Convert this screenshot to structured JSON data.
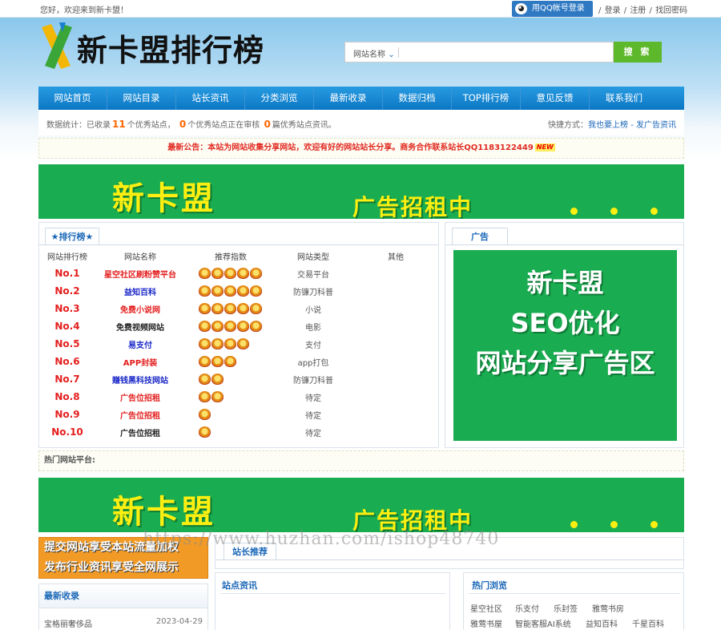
{
  "topbar": {
    "welcome": "您好，欢迎来到新卡盟！",
    "qq_icon": "qq-penguin-icon",
    "qq_login": "用QQ帐号登录",
    "links": [
      "登录",
      "注册",
      "找回密码"
    ],
    "sep": "/"
  },
  "header": {
    "logo_text": "新卡盟排行榜",
    "logo_colors": [
      "#f2b705",
      "#3aa637",
      "#1b7fd1"
    ],
    "search_select": "网站名称",
    "search_button": "搜 索"
  },
  "nav": [
    "网站首页",
    "网站目录",
    "站长资讯",
    "分类浏览",
    "最新收录",
    "数据归档",
    "TOP排行榜",
    "意见反馈",
    "联系我们"
  ],
  "stats": {
    "p1": "数据统计：已收录",
    "n1": "11",
    "p2": "个优秀站点，",
    "n2": "0",
    "p3": "个优秀站点正在审核",
    "n3": "0",
    "p4": "篇优秀站点资讯。",
    "shortcut_label": "快捷方式：",
    "shortcut_link1": "我也要上榜",
    "shortcut_sep": " - ",
    "shortcut_link2": "发广告资讯"
  },
  "notice": {
    "text": "最新公告：本站为网站收集分享网站，欢迎有好的网站站长分享。商务合作联系站长QQ1183122449",
    "badge": "NEW"
  },
  "banner1": {
    "big": "新卡盟",
    "small": "广告招租中"
  },
  "ranking": {
    "tab": "★排行榜★",
    "headers": [
      "网站排行榜",
      "网站名称",
      "推荐指数",
      "网站类型",
      "其他"
    ],
    "rows": [
      {
        "no": "No.1",
        "name": "星空社区刷粉赞平台",
        "stars": 5,
        "type": "交易平台",
        "color": "#e41e1e"
      },
      {
        "no": "No.2",
        "name": "益知百科",
        "stars": 5,
        "type": "防镰刀科普",
        "color": "#1a27c8"
      },
      {
        "no": "No.3",
        "name": "免费小说网",
        "stars": 5,
        "type": "小说",
        "color": "#e41e1e"
      },
      {
        "no": "No.4",
        "name": "免费视频网站",
        "stars": 5,
        "type": "电影",
        "color": "#222222"
      },
      {
        "no": "No.5",
        "name": "易支付",
        "stars": 4,
        "type": "支付",
        "color": "#1a27c8"
      },
      {
        "no": "No.6",
        "name": "APP封装",
        "stars": 3,
        "type": "app打包",
        "color": "#e41e1e"
      },
      {
        "no": "No.7",
        "name": "赚钱黑科技网站",
        "stars": 2,
        "type": "防镰刀科普",
        "color": "#1a27c8"
      },
      {
        "no": "No.8",
        "name": "广告位招租",
        "stars": 2,
        "type": "待定",
        "color": "#e41e1e"
      },
      {
        "no": "No.9",
        "name": "广告位招租",
        "stars": 1,
        "type": "待定",
        "color": "#e41e1e"
      },
      {
        "no": "No.10",
        "name": "广告位招租",
        "stars": 1,
        "type": "待定",
        "color": "#222222"
      }
    ]
  },
  "ad": {
    "tab": "广告",
    "lines": [
      "新卡盟",
      "SEO优化",
      "网站分享广告区"
    ]
  },
  "hot_sites_label": "热门网站平台:",
  "banner2": {
    "big": "新卡盟",
    "small": "广告招租中"
  },
  "submit_banner": [
    "提交网站享受本站流量加权",
    "发布行业资讯享受全网展示"
  ],
  "newest": {
    "title": "最新收录",
    "item": "宝格丽奢侈品",
    "date": "2023-04-29"
  },
  "recommend_tab": "站长推荐",
  "news_title": "站点资讯",
  "hot_browse": {
    "title": "热门浏览",
    "links": [
      "星空社区",
      "乐支付",
      "乐封签",
      "雅莺书房",
      "雅莺书屋",
      "智能客服AI系统",
      "益知百科",
      "千星百科"
    ]
  },
  "watermark": "https://www.huzhan.com/ishop48740"
}
